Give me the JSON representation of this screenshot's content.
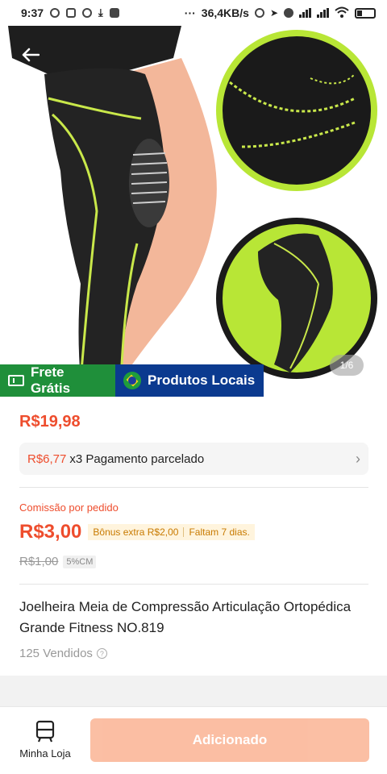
{
  "status_bar": {
    "time": "9:37",
    "network_speed": "36,4KB/s",
    "icons": [
      "notification-icon",
      "shopping-icon",
      "download-icon",
      "alarm-icon",
      "signal-icon",
      "wifi-icon",
      "battery-icon"
    ]
  },
  "gallery": {
    "counter": "1/6"
  },
  "badges": {
    "shipping": "Frete Grátis",
    "local": "Produtos Locais"
  },
  "product": {
    "price": "R$19,98",
    "installment_value": "R$6,77",
    "installment_text": "x3 Pagamento parcelado",
    "commission_label": "Comissão por pedido",
    "commission_value": "R$3,00",
    "bonus_text": "Bônus extra R$2,00",
    "bonus_days": "Faltam 7 dias.",
    "old_commission": "R$1,00",
    "cm_tag": "5%CM",
    "title": "Joelheira Meia de Compressão Articulação Ortopédica Grande Fitness NO.819",
    "sold": "125 Vendidos"
  },
  "bottom_bar": {
    "store_label": "Minha Loja",
    "add_label": "Adicionado"
  },
  "colors": {
    "accent": "#ee4d2d",
    "badge_green": "#1f8f3a",
    "badge_blue": "#0b3a8f",
    "product_neon": "#b8e636"
  }
}
